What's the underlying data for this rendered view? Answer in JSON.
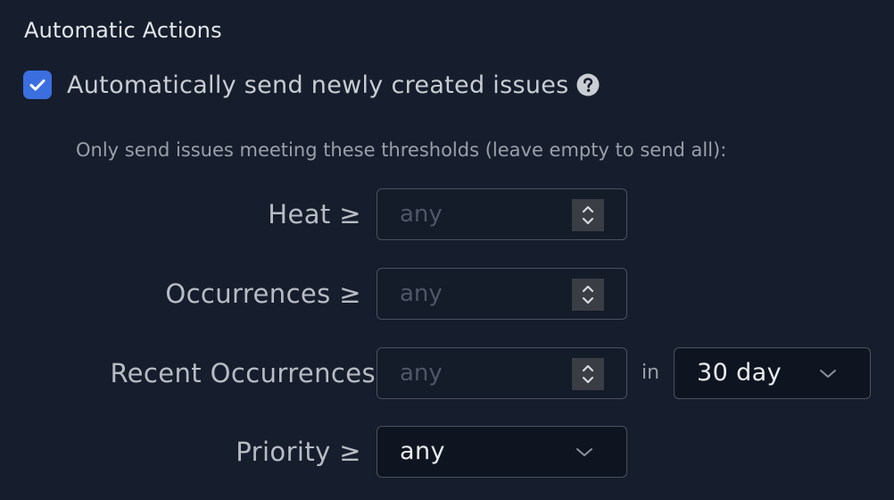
{
  "section": {
    "title": "Automatic Actions"
  },
  "auto_send": {
    "checked": true,
    "label": "Automatically send newly created issues"
  },
  "thresholds": {
    "hint": "Only send issues meeting these thresholds (leave empty to send all):",
    "heat": {
      "label": "Heat ≥",
      "placeholder": "any"
    },
    "occurrences": {
      "label": "Occurrences ≥",
      "placeholder": "any"
    },
    "recent_occurrences": {
      "label": "Recent Occurrences",
      "placeholder": "any",
      "in_label": "in",
      "window_value": "30 day"
    },
    "priority": {
      "label": "Priority ≥",
      "value": "any"
    }
  },
  "colors": {
    "background": "#161d2c",
    "checkbox_accent": "#3b6fe0",
    "input_border": "#4a5061"
  }
}
